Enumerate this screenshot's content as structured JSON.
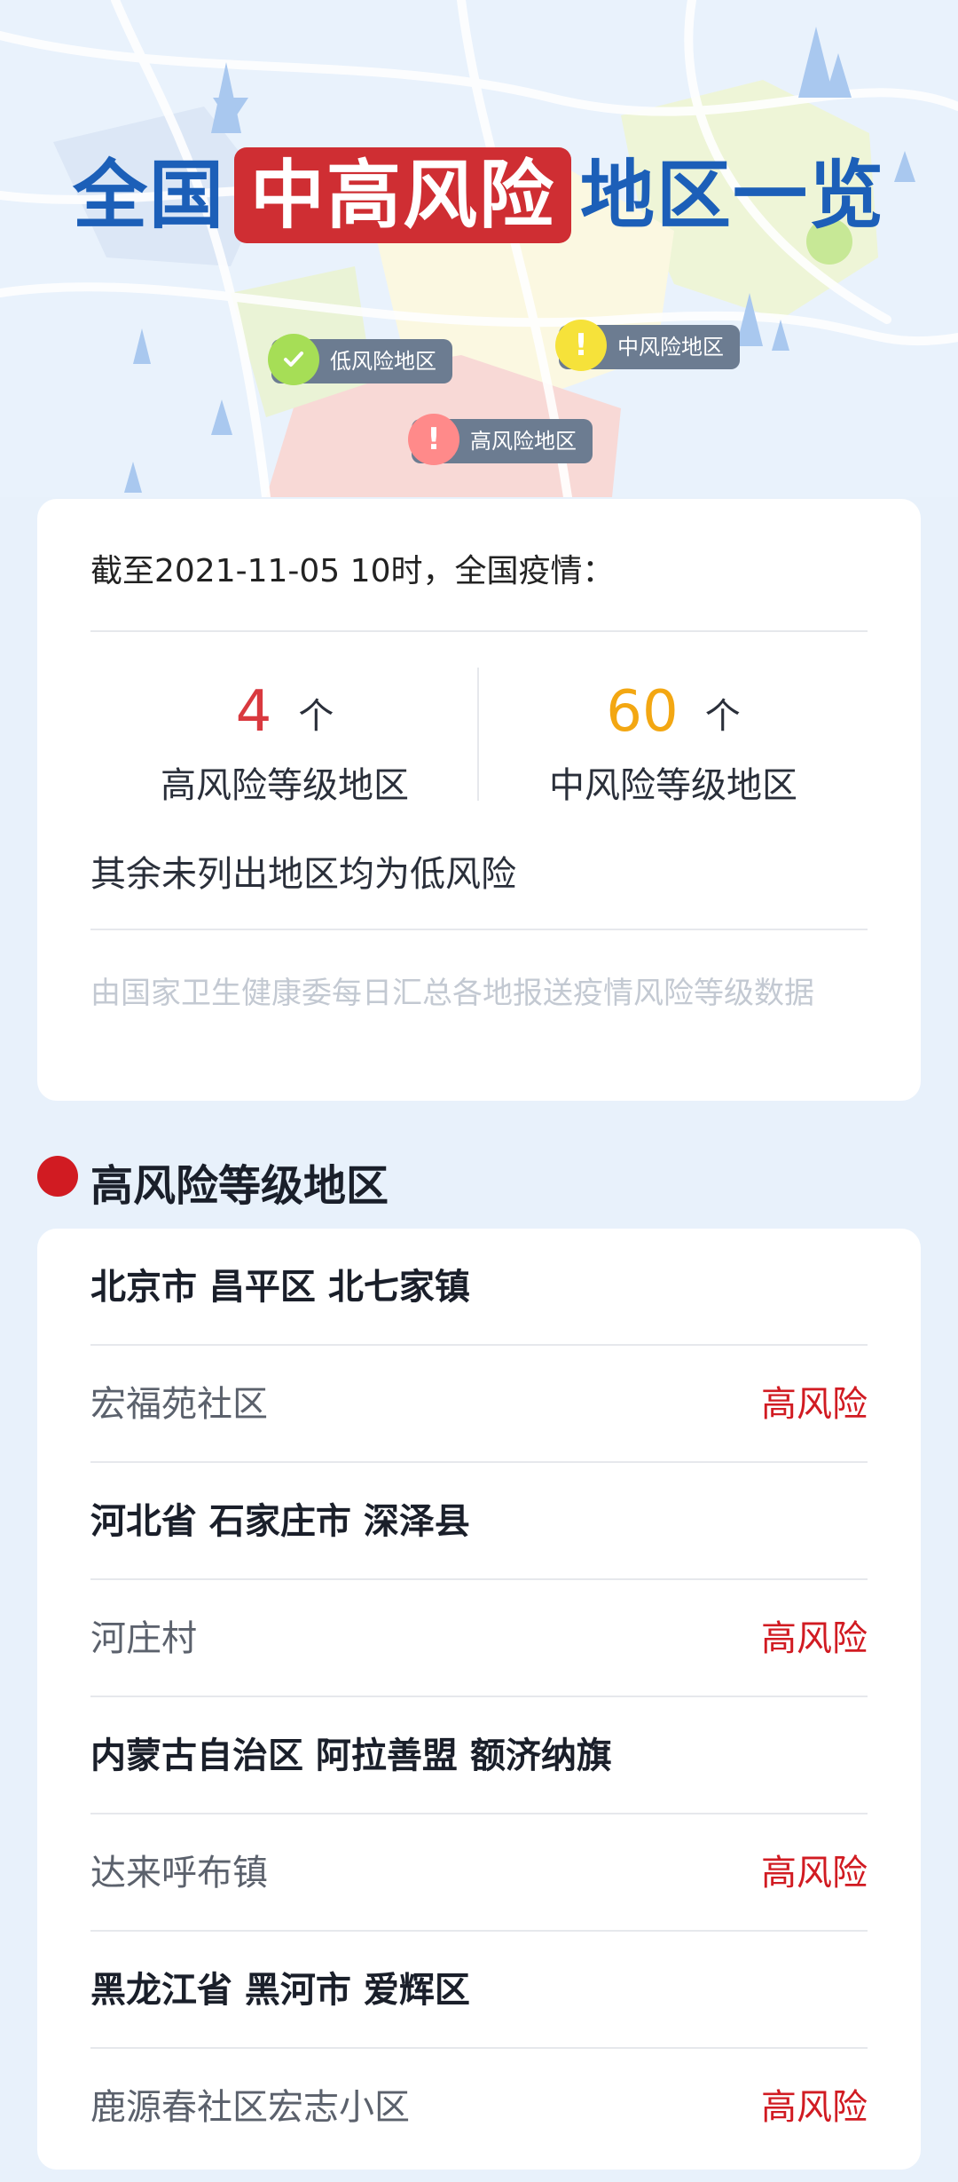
{
  "hero": {
    "title_before": "全国",
    "title_highlight": "中高风险",
    "title_after": "地区一览",
    "legend": [
      {
        "label": "低风险地区",
        "color": "#a6de56",
        "icon": "check-icon"
      },
      {
        "label": "中风险地区",
        "color": "#f6e23a",
        "icon": "exclamation-icon"
      },
      {
        "label": "高风险地区",
        "color": "#ff8a8a",
        "icon": "exclamation-icon"
      }
    ]
  },
  "summary": {
    "as_of": "截至2021-11-05 10时，全国疫情：",
    "high": {
      "count": "4",
      "unit": "个",
      "label": "高风险等级地区",
      "color": "#d9393f"
    },
    "medium": {
      "count": "60",
      "unit": "个",
      "label": "中风险等级地区",
      "color": "#f3a712"
    },
    "note": "其余未列出地区均为低风险",
    "source": "由国家卫生健康委每日汇总各地报送疫情风险等级数据"
  },
  "section": {
    "title": "高风险等级地区",
    "accent": "#d11b22"
  },
  "regions": [
    {
      "area": "北京市 昌平区 北七家镇",
      "place": "宏福苑社区",
      "level": "高风险"
    },
    {
      "area": "河北省 石家庄市 深泽县",
      "place": "河庄村",
      "level": "高风险"
    },
    {
      "area": "内蒙古自治区 阿拉善盟 额济纳旗",
      "place": "达来呼布镇",
      "level": "高风险"
    },
    {
      "area": "黑龙江省 黑河市 爱辉区",
      "place": "鹿源春社区宏志小区",
      "level": "高风险"
    }
  ]
}
